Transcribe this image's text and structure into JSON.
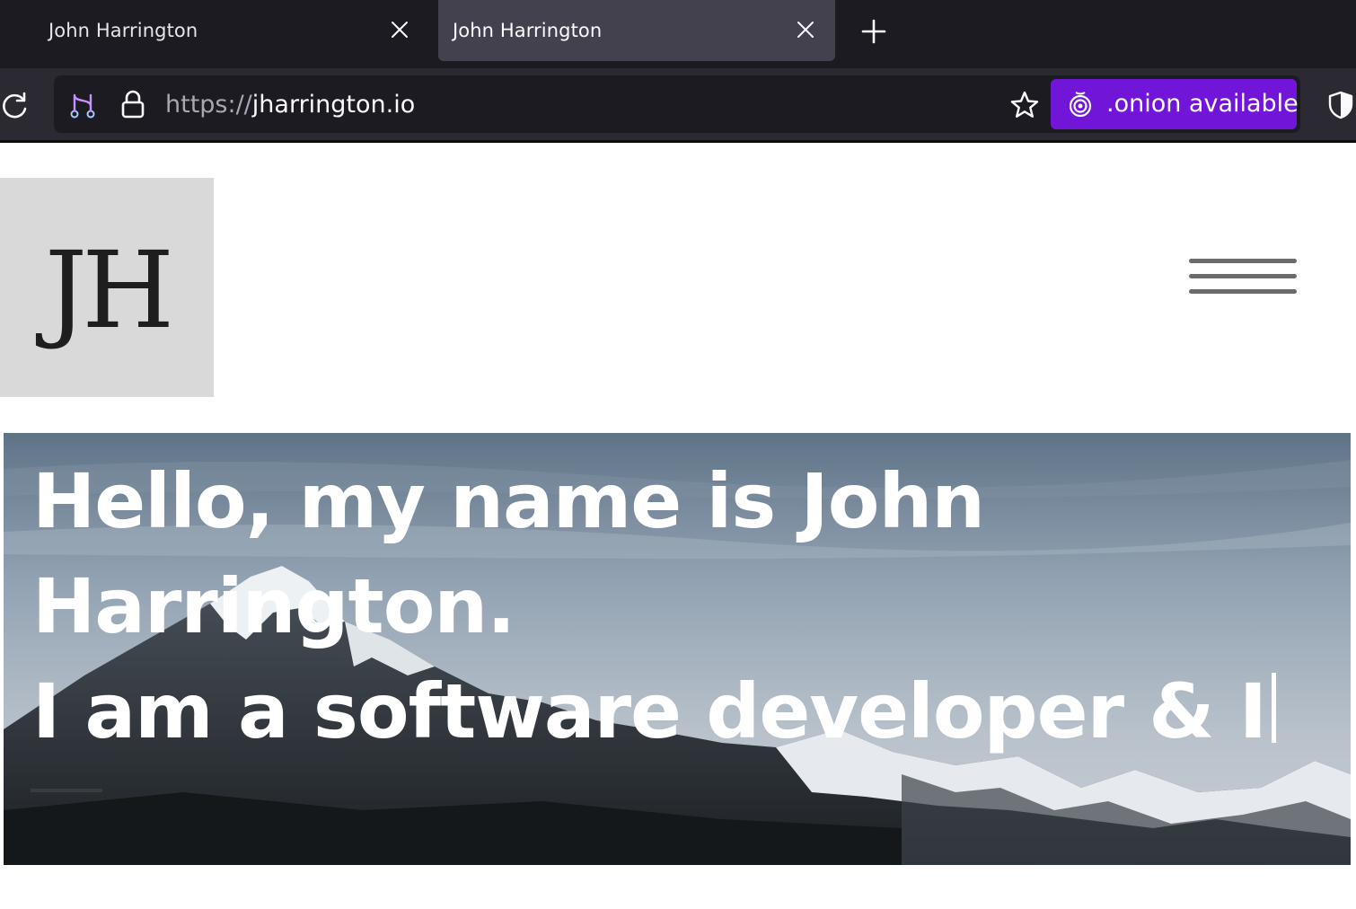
{
  "browser": {
    "tabs": [
      {
        "title": "John Harrington",
        "active": false
      },
      {
        "title": "John Harrington",
        "active": true
      }
    ],
    "url": {
      "scheme": "https://",
      "host": "jharrington.io"
    },
    "onion_button_label": ".onion available",
    "colors": {
      "tabstrip": "#1c1b22",
      "active_tab": "#42414d",
      "onion_accent": "#7116d8"
    }
  },
  "page": {
    "logo_text": "JH",
    "hero": {
      "line1": "Hello, my name is John",
      "line2": "Harrington.",
      "line3": "I am a software developer & I"
    }
  },
  "icons": [
    "close-icon",
    "plus-icon",
    "reload-icon",
    "tracking-protection-icon",
    "lock-icon",
    "star-icon",
    "onion-icon",
    "shield-icon",
    "hamburger-menu-icon"
  ]
}
